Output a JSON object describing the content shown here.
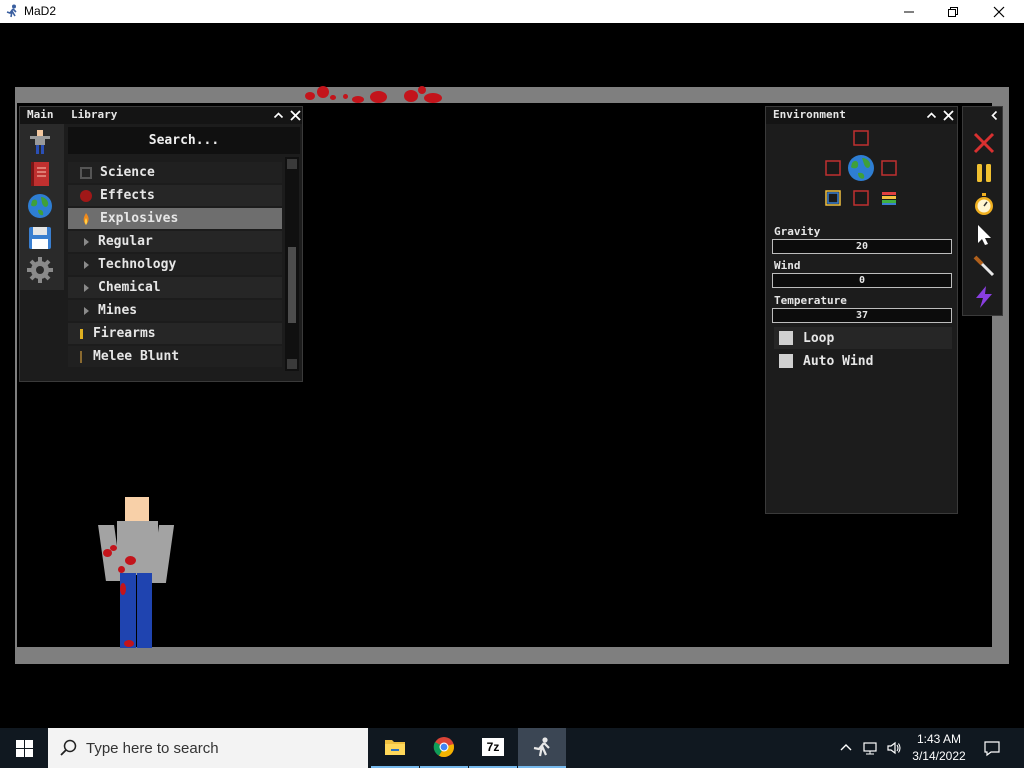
{
  "window": {
    "title": "MaD2",
    "icon": "ragdoll-app-icon",
    "minimize": "minimize-icon",
    "restore": "restore-icon",
    "close": "close-icon"
  },
  "library_panel": {
    "tab_main": "Main",
    "tab_library": "Library",
    "search_label": "Search...",
    "side_icons": [
      "ragdoll-icon",
      "notebook-icon",
      "globe-icon",
      "floppy-disk-icon",
      "gear-icon"
    ],
    "items": [
      {
        "label": "Science",
        "icon": "chip-icon",
        "level": 0
      },
      {
        "label": "Effects",
        "icon": "red-blob-icon",
        "level": 0
      },
      {
        "label": "Explosives",
        "icon": "flame-icon",
        "level": 0,
        "selected": true
      },
      {
        "label": "Regular",
        "icon": "expand-arrow-icon",
        "level": 1
      },
      {
        "label": "Technology",
        "icon": "expand-arrow-icon",
        "level": 1
      },
      {
        "label": "Chemical",
        "icon": "expand-arrow-icon",
        "level": 1
      },
      {
        "label": "Mines",
        "icon": "expand-arrow-icon",
        "level": 1
      },
      {
        "label": "Firearms",
        "icon": "bullet-icon",
        "level": 0
      },
      {
        "label": "Melee Blunt",
        "icon": "bat-icon",
        "level": 0
      }
    ]
  },
  "environment_panel": {
    "title": "Environment",
    "gravity_label": "Gravity",
    "gravity_value": "20",
    "wind_label": "Wind",
    "wind_value": "0",
    "temperature_label": "Temperature",
    "temperature_value": "37",
    "loop_label": "Loop",
    "loop_checked": false,
    "auto_wind_label": "Auto Wind",
    "auto_wind_checked": false
  },
  "toolbar": {
    "collapse": "chevron-left-icon",
    "tools": [
      "delete-icon",
      "pause-icon",
      "stopwatch-icon",
      "cursor-icon",
      "knife-icon",
      "lightning-icon"
    ]
  },
  "taskbar": {
    "search_placeholder": "Type here to search",
    "apps": [
      "file-explorer-icon",
      "chrome-icon",
      "7zip-icon",
      "mad2-icon"
    ],
    "app_7z_label": "7z",
    "time": "1:43 AM",
    "date": "3/14/2022"
  },
  "colors": {
    "blood": "#c3141b",
    "panel": "#1c1c1c",
    "selected_row": "#6e6e6e",
    "taskbar": "#101820"
  }
}
